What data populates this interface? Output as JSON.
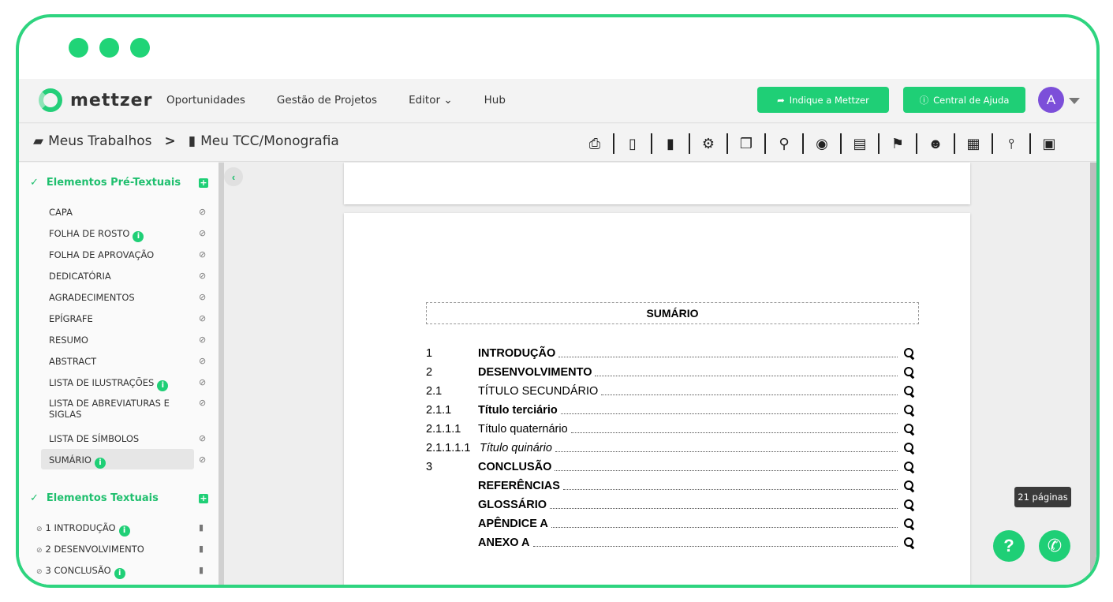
{
  "window": {
    "traffic_lights": [
      "#20d477",
      "#20d477",
      "#20d477"
    ]
  },
  "topbar": {
    "logo_text": "mettzer",
    "nav": [
      "Oportunidades",
      "Gestão de Projetos",
      "Editor ⌄",
      "Hub"
    ],
    "indique_label": "Indique a Mettzer",
    "ajuda_label": "Central de Ajuda",
    "avatar_letter": "A",
    "accent_color": "#1fcf76"
  },
  "breadcrumb": {
    "root": "Meus Trabalhos",
    "separator": ">",
    "current": "Meu TCC/Monografia"
  },
  "toolbar_icons": [
    "print-icon",
    "word-export-icon",
    "file-upload-icon",
    "settings-icon",
    "copy-icon",
    "binoculars-icon",
    "globe-icon",
    "book-icon",
    "flag-icon",
    "users-icon",
    "calendar-icon",
    "thermometer-icon",
    "save-icon"
  ],
  "sidebar": {
    "pre_textual": {
      "title": "Elementos Pré-Textuais",
      "items": [
        "CAPA",
        "FOLHA DE ROSTO",
        "FOLHA DE APROVAÇÃO",
        "DEDICATÓRIA",
        "AGRADECIMENTOS",
        "EPÍGRAFE",
        "RESUMO",
        "ABSTRACT",
        "LISTA DE ILUSTRAÇÕES",
        "LISTA DE ABREVIATURAS E SIGLAS",
        "LISTA DE SÍMBOLOS",
        "SUMÁRIO"
      ]
    },
    "textual": {
      "title": "Elementos Textuais",
      "items": [
        "1 INTRODUÇÃO",
        "2 DESENVOLVIMENTO",
        "3 CONCLUSÃO"
      ]
    }
  },
  "document": {
    "summary_title": "SUMÁRIO",
    "toc": [
      {
        "num": "1",
        "label": "INTRODUÇÃO"
      },
      {
        "num": "2",
        "label": "DESENVOLVIMENTO"
      },
      {
        "num": "2.1",
        "label": "TÍTULO SECUNDÁRIO"
      },
      {
        "num": "2.1.1",
        "label": "Título terciário"
      },
      {
        "num": "2.1.1.1",
        "label": "Título quaternário"
      },
      {
        "num": "2.1.1.1.1",
        "label": "Título quinário"
      },
      {
        "num": "3",
        "label": "CONCLUSÃO"
      },
      {
        "num": "",
        "label": "REFERÊNCIAS"
      },
      {
        "num": "",
        "label": "GLOSSÁRIO"
      },
      {
        "num": "",
        "label": "APÊNDICE A"
      },
      {
        "num": "",
        "label": "ANEXO A"
      }
    ]
  },
  "status": {
    "pages_label": "21 páginas"
  }
}
